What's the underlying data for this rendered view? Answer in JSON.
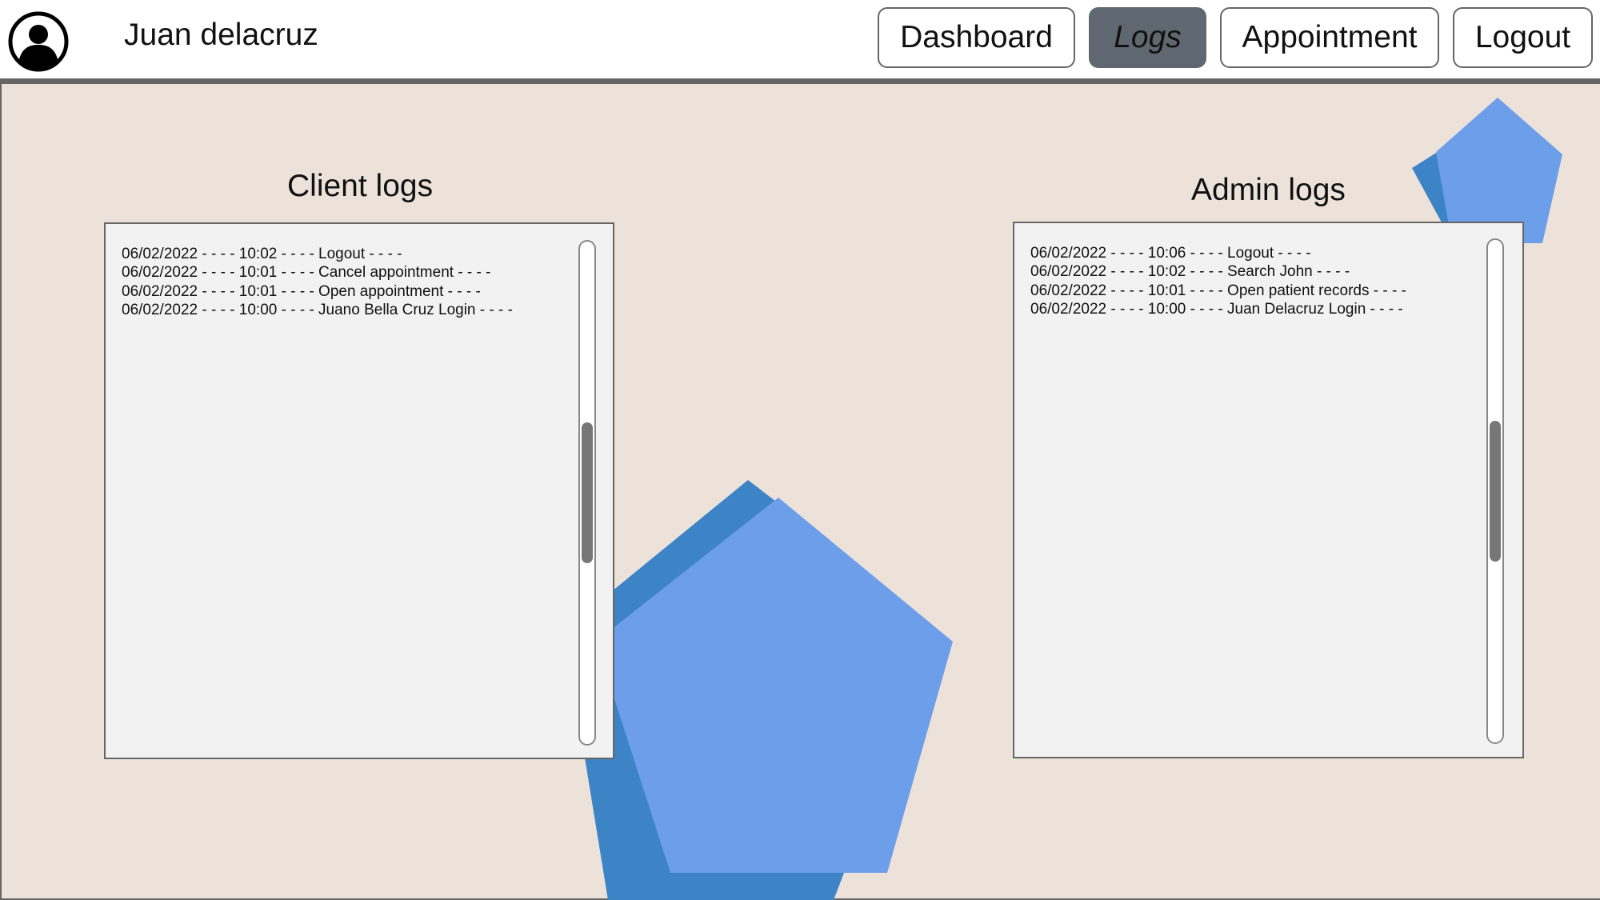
{
  "header": {
    "username": "Juan delacruz",
    "avatar_icon": "user-avatar-icon",
    "nav": [
      {
        "label": "Dashboard",
        "active": false
      },
      {
        "label": "Logs",
        "active": true
      },
      {
        "label": "Appointment",
        "active": false
      },
      {
        "label": "Logout",
        "active": false
      }
    ]
  },
  "client_logs": {
    "title": "Client logs",
    "entries": [
      "06/02/2022 - - - - 10:02 - - - - Logout - - - -",
      "06/02/2022 - - - - 10:01 - - - - Cancel appointment - - - -",
      "06/02/2022 - - - - 10:01 - - - - Open appointment - - - -",
      "06/02/2022 - - - - 10:00 - - - - Juano Bella Cruz Login - - - -"
    ]
  },
  "admin_logs": {
    "title": "Admin logs",
    "entries": [
      "06/02/2022 - - - - 10:06 - - - - Logout - - - -",
      "06/02/2022 - - - - 10:02 - - - - Search John - - - -",
      "06/02/2022 - - - - 10:01 - - - - Open patient records - - - -",
      "06/02/2022 - - - - 10:00 - - - - Juan Delacruz Login - - - -"
    ]
  },
  "colors": {
    "background": "#ece2da",
    "active_nav": "#5f6870",
    "pentagon_light": "#6d9eea",
    "pentagon_dark": "#3d84c6"
  }
}
